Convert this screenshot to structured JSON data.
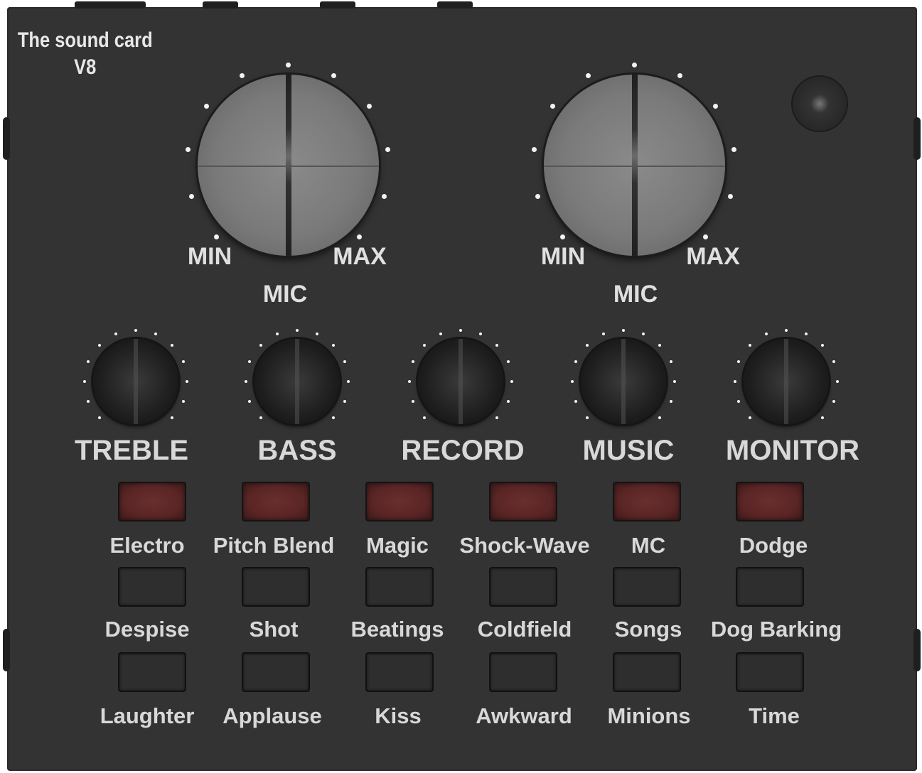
{
  "brand": {
    "line1": "The sound card",
    "line2": "V8"
  },
  "mic_knobs": [
    {
      "min": "MIN",
      "max": "MAX",
      "name": "MIC"
    },
    {
      "min": "MIN",
      "max": "MAX",
      "name": "MIC"
    }
  ],
  "small_knobs": [
    "TREBLE",
    "BASS",
    "RECORD",
    "MUSIC",
    "MONITOR"
  ],
  "effect_buttons": [
    "Electro",
    "Pitch Blend",
    "Magic",
    "Shock-Wave",
    "MC",
    "Dodge"
  ],
  "sound_buttons_row1": [
    "Despise",
    "Shot",
    "Beatings",
    "Coldfield",
    "Songs",
    "Dog Barking"
  ],
  "sound_buttons_row2": [
    "Laughter",
    "Applause",
    "Kiss",
    "Awkward",
    "Minions",
    "Time"
  ],
  "colors": {
    "body": "#333333",
    "led_button": "#5a2525",
    "label": "#d8d8d8"
  }
}
